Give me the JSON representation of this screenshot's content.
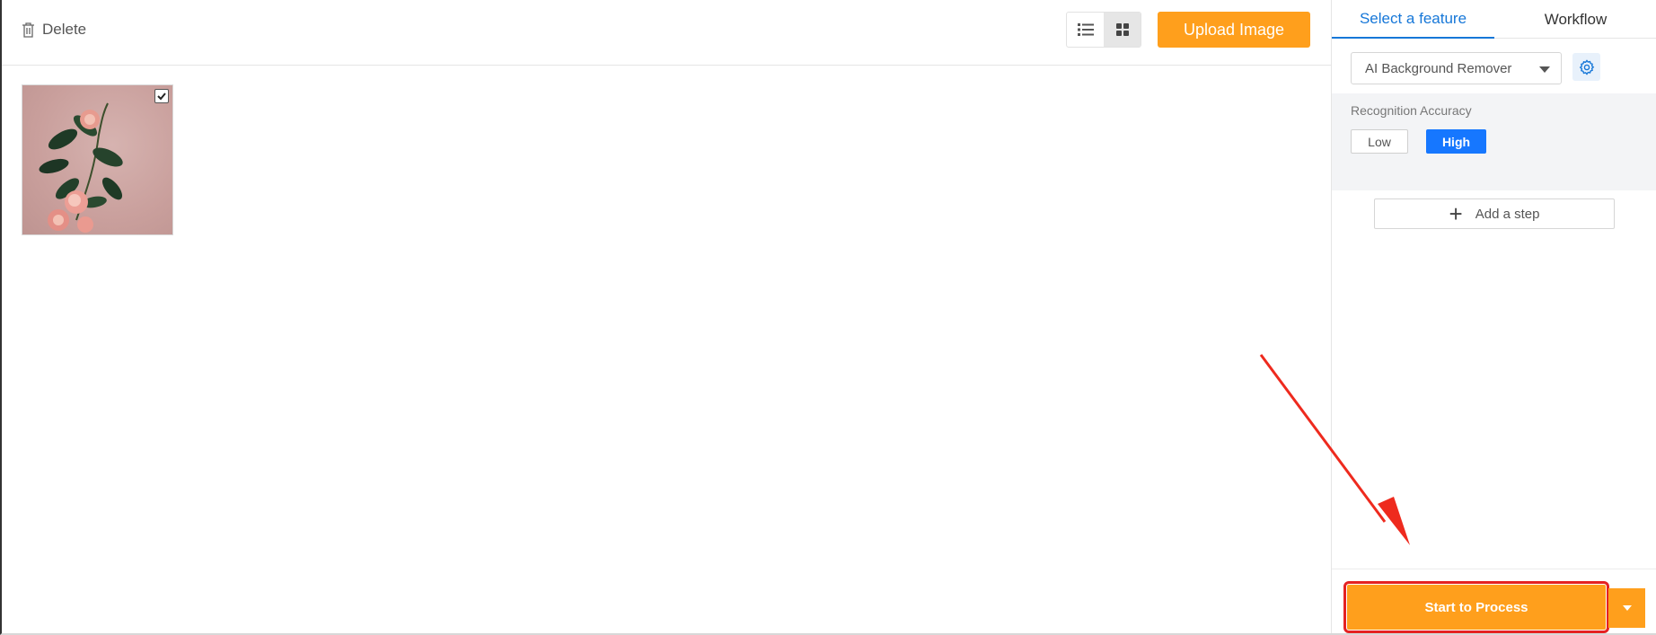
{
  "toolbar": {
    "delete_label": "Delete",
    "upload_label": "Upload Image",
    "view_modes": [
      "list",
      "grid"
    ],
    "active_view": "grid"
  },
  "gallery": {
    "items": [
      {
        "checked": true,
        "description_icon": "flower-photo"
      }
    ]
  },
  "panel": {
    "tabs": [
      {
        "label": "Select a feature",
        "active": true
      },
      {
        "label": "Workflow",
        "active": false
      }
    ],
    "feature_select": {
      "value": "AI Background Remover"
    },
    "accuracy": {
      "label": "Recognition Accuracy",
      "options": [
        "Low",
        "High"
      ],
      "selected": "High"
    },
    "add_step_label": "Add a step",
    "start_label": "Start to Process"
  },
  "colors": {
    "accent_orange": "#ff9f1c",
    "accent_blue": "#1677ff",
    "highlight_red": "#e52222"
  }
}
